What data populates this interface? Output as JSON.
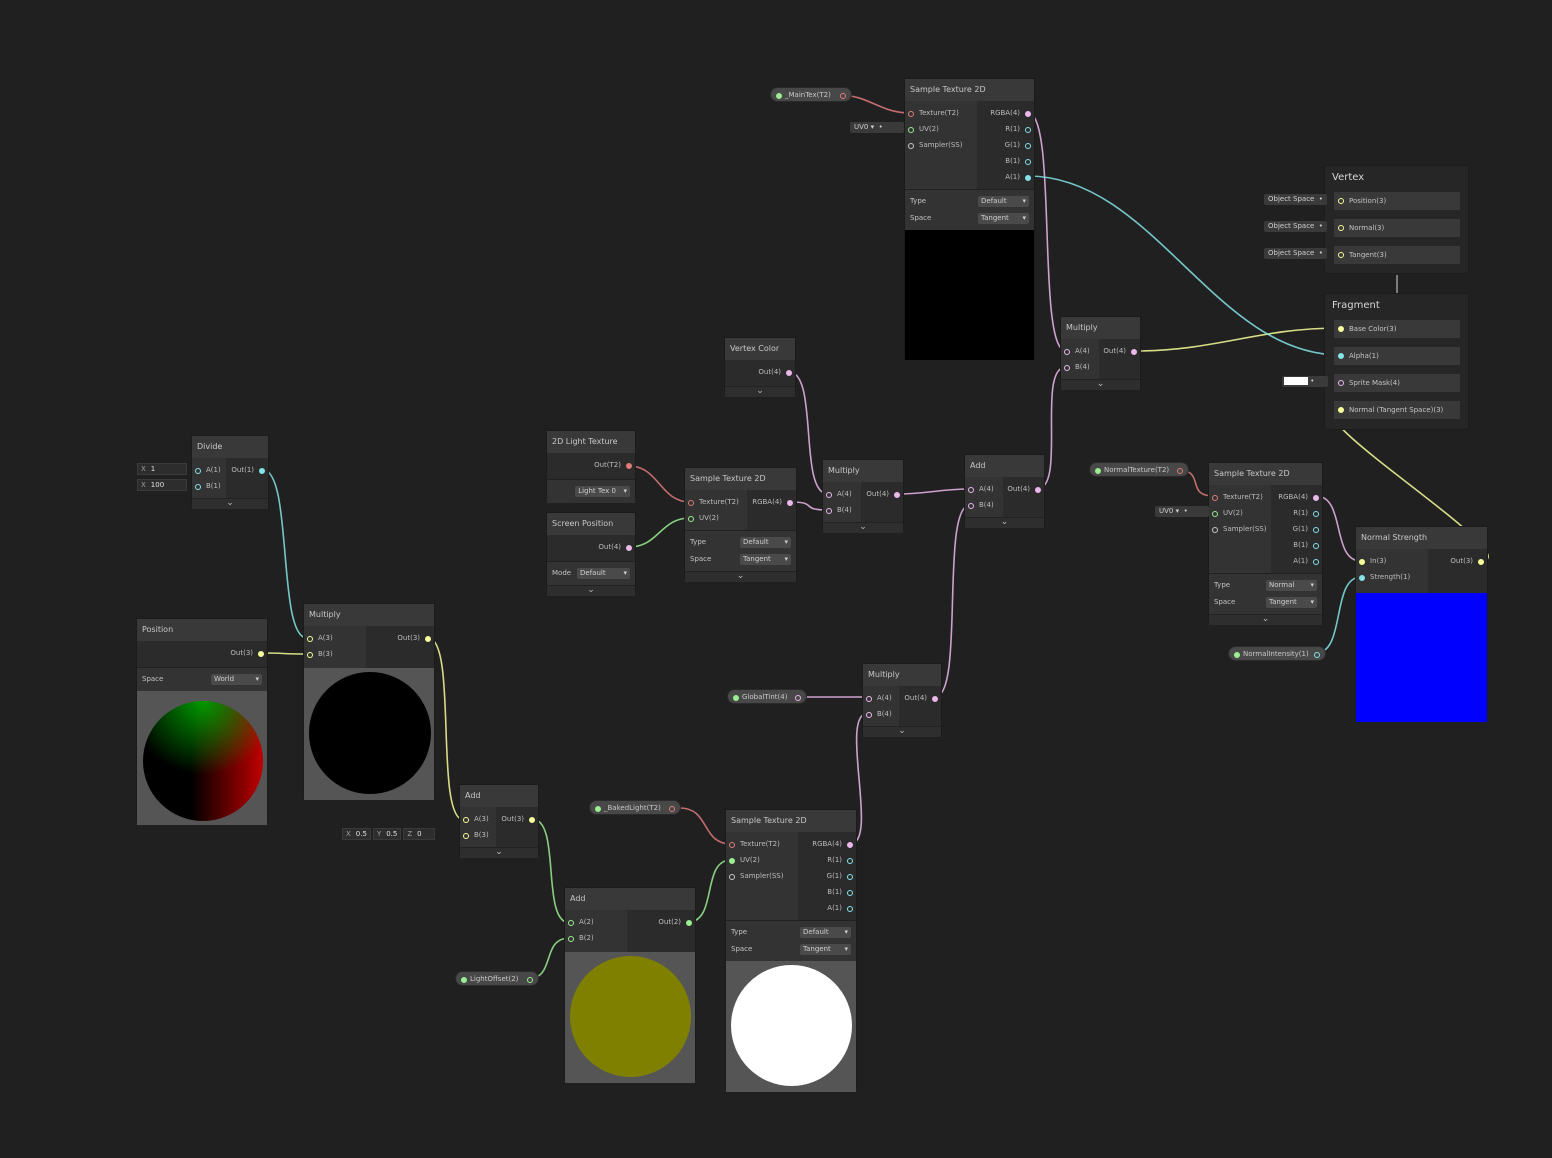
{
  "colors": {
    "background": "#202020",
    "texture_port": "#e17a7a",
    "vector4_port": "#ecb8ec",
    "vector3_port": "#f6ff9a",
    "vector2_port": "#9aef92",
    "vector1_port": "#84e4e7",
    "sampler_port": "#c8c8c8"
  },
  "nodes": {
    "divide": {
      "title": "Divide",
      "inputs": [
        "A(1)",
        "B(1)"
      ],
      "outputs": [
        "Out(1)"
      ],
      "a_field": {
        "label": "X",
        "value": "1"
      },
      "b_field": {
        "label": "X",
        "value": "100"
      }
    },
    "position": {
      "title": "Position",
      "outputs": [
        "Out(3)"
      ],
      "space_label": "Space",
      "space_value": "World"
    },
    "multiply_1": {
      "title": "Multiply",
      "inputs": [
        "A(3)",
        "B(3)"
      ],
      "outputs": [
        "Out(3)"
      ]
    },
    "add_1": {
      "title": "Add",
      "inputs": [
        "A(3)",
        "B(3)"
      ],
      "outputs": [
        "Out(3)"
      ],
      "b_field": {
        "x_label": "X",
        "x": "0.5",
        "y_label": "Y",
        "y": "0.5",
        "z_label": "Z",
        "z": "0"
      }
    },
    "add_2": {
      "title": "Add",
      "inputs": [
        "A(2)",
        "B(2)"
      ],
      "outputs": [
        "Out(2)"
      ]
    },
    "light_texture": {
      "title": "2D Light Texture",
      "outputs": [
        "Out(T2)"
      ],
      "dropdown": "Light Tex 0"
    },
    "screen_position": {
      "title": "Screen Position",
      "outputs": [
        "Out(4)"
      ],
      "mode_label": "Mode",
      "mode_value": "Default"
    },
    "sample_tex_1": {
      "title": "Sample Texture 2D",
      "inputs": [
        "Texture(T2)",
        "UV(2)"
      ],
      "outputs": [
        "RGBA(4)"
      ],
      "type_label": "Type",
      "type_value": "Default",
      "space_label": "Space",
      "space_value": "Tangent"
    },
    "vertex_color": {
      "title": "Vertex Color",
      "outputs": [
        "Out(4)"
      ]
    },
    "multiply_2": {
      "title": "Multiply",
      "inputs": [
        "A(4)",
        "B(4)"
      ],
      "outputs": [
        "Out(4)"
      ]
    },
    "add_3": {
      "title": "Add",
      "inputs": [
        "A(4)",
        "B(4)"
      ],
      "outputs": [
        "Out(4)"
      ]
    },
    "multiply_3": {
      "title": "Multiply",
      "inputs": [
        "A(4)",
        "B(4)"
      ],
      "outputs": [
        "Out(4)"
      ]
    },
    "multiply_4": {
      "title": "Multiply",
      "inputs": [
        "A(4)",
        "B(4)"
      ],
      "outputs": [
        "Out(4)"
      ]
    },
    "sample_tex_main": {
      "title": "Sample Texture 2D",
      "inputs": [
        "Texture(T2)",
        "UV(2)",
        "Sampler(SS)"
      ],
      "outputs": [
        "RGBA(4)",
        "R(1)",
        "G(1)",
        "B(1)",
        "A(1)"
      ],
      "type_label": "Type",
      "type_value": "Default",
      "space_label": "Space",
      "space_value": "Tangent",
      "uv_dropdown": "UV0"
    },
    "sample_tex_baked": {
      "title": "Sample Texture 2D",
      "inputs": [
        "Texture(T2)",
        "UV(2)",
        "Sampler(SS)"
      ],
      "outputs": [
        "RGBA(4)",
        "R(1)",
        "G(1)",
        "B(1)",
        "A(1)"
      ],
      "type_label": "Type",
      "type_value": "Default",
      "space_label": "Space",
      "space_value": "Tangent"
    },
    "sample_tex_normal": {
      "title": "Sample Texture 2D",
      "inputs": [
        "Texture(T2)",
        "UV(2)",
        "Sampler(SS)"
      ],
      "outputs": [
        "RGBA(4)",
        "R(1)",
        "G(1)",
        "B(1)",
        "A(1)"
      ],
      "type_label": "Type",
      "type_value": "Normal",
      "space_label": "Space",
      "space_value": "Tangent",
      "uv_dropdown": "UV0"
    },
    "normal_strength": {
      "title": "Normal Strength",
      "inputs": [
        "In(3)",
        "Strength(1)"
      ],
      "outputs": [
        "Out(3)"
      ]
    }
  },
  "properties": {
    "main_tex": "_MainTex(T2)",
    "global_tint": "GlobalTint(4)",
    "baked_light": "_BakedLight(T2)",
    "light_offset": "LightOffset(2)",
    "normal_texture": "NormalTexture(T2)",
    "normal_intensity": "NormalIntensity(1)"
  },
  "master": {
    "vertex": {
      "title": "Vertex",
      "blocks": [
        "Position(3)",
        "Normal(3)",
        "Tangent(3)"
      ],
      "space_fields": [
        "Object Space",
        "Object Space",
        "Object Space"
      ]
    },
    "fragment": {
      "title": "Fragment",
      "blocks": [
        "Base Color(3)",
        "Alpha(1)",
        "Sprite Mask(4)",
        "Normal (Tangent Space)(3)"
      ]
    }
  }
}
